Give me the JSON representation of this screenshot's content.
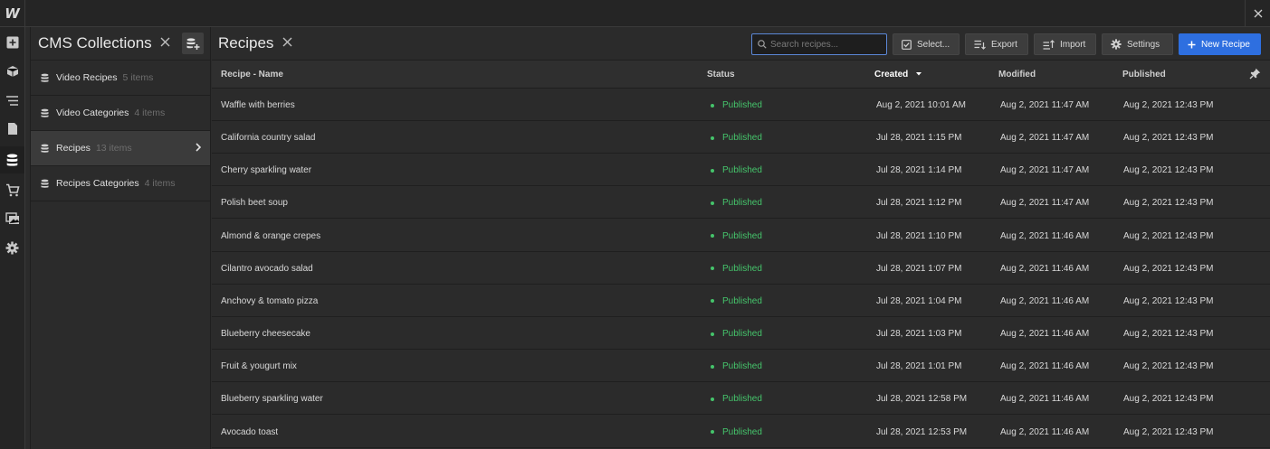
{
  "app": {
    "logo": "W"
  },
  "collections": {
    "title": "CMS Collections",
    "items": [
      {
        "name": "Video Recipes",
        "count": "5 items"
      },
      {
        "name": "Video Categories",
        "count": "4 items"
      },
      {
        "name": "Recipes",
        "count": "13 items"
      },
      {
        "name": "Recipes Categories",
        "count": "4 items"
      }
    ]
  },
  "main": {
    "title": "Recipes",
    "search_placeholder": "Search recipes...",
    "buttons": {
      "select": "Select...",
      "export": "Export",
      "import": "Import",
      "settings": "Settings",
      "new": "New Recipe"
    },
    "columns": {
      "name": "Recipe - Name",
      "status": "Status",
      "created": "Created",
      "modified": "Modified",
      "published": "Published"
    },
    "rows": [
      {
        "name": "Waffle with berries",
        "status": "Published",
        "created": "Aug 2, 2021 10:01 AM",
        "modified": "Aug 2, 2021 11:47 AM",
        "published": "Aug 2, 2021 12:43 PM"
      },
      {
        "name": "California country salad",
        "status": "Published",
        "created": "Jul 28, 2021 1:15 PM",
        "modified": "Aug 2, 2021 11:47 AM",
        "published": "Aug 2, 2021 12:43 PM"
      },
      {
        "name": "Cherry sparkling water",
        "status": "Published",
        "created": "Jul 28, 2021 1:14 PM",
        "modified": "Aug 2, 2021 11:47 AM",
        "published": "Aug 2, 2021 12:43 PM"
      },
      {
        "name": "Polish beet soup",
        "status": "Published",
        "created": "Jul 28, 2021 1:12 PM",
        "modified": "Aug 2, 2021 11:47 AM",
        "published": "Aug 2, 2021 12:43 PM"
      },
      {
        "name": "Almond & orange crepes",
        "status": "Published",
        "created": "Jul 28, 2021 1:10 PM",
        "modified": "Aug 2, 2021 11:46 AM",
        "published": "Aug 2, 2021 12:43 PM"
      },
      {
        "name": "Cilantro avocado salad",
        "status": "Published",
        "created": "Jul 28, 2021 1:07 PM",
        "modified": "Aug 2, 2021 11:46 AM",
        "published": "Aug 2, 2021 12:43 PM"
      },
      {
        "name": "Anchovy & tomato pizza",
        "status": "Published",
        "created": "Jul 28, 2021 1:04 PM",
        "modified": "Aug 2, 2021 11:46 AM",
        "published": "Aug 2, 2021 12:43 PM"
      },
      {
        "name": "Blueberry cheesecake",
        "status": "Published",
        "created": "Jul 28, 2021 1:03 PM",
        "modified": "Aug 2, 2021 11:46 AM",
        "published": "Aug 2, 2021 12:43 PM"
      },
      {
        "name": "Fruit & yougurt mix",
        "status": "Published",
        "created": "Jul 28, 2021 1:01 PM",
        "modified": "Aug 2, 2021 11:46 AM",
        "published": "Aug 2, 2021 12:43 PM"
      },
      {
        "name": "Blueberry sparkling water",
        "status": "Published",
        "created": "Jul 28, 2021 12:58 PM",
        "modified": "Aug 2, 2021 11:46 AM",
        "published": "Aug 2, 2021 12:43 PM"
      },
      {
        "name": "Avocado toast",
        "status": "Published",
        "created": "Jul 28, 2021 12:53 PM",
        "modified": "Aug 2, 2021 11:46 AM",
        "published": "Aug 2, 2021 12:43 PM"
      }
    ]
  },
  "colors": {
    "accent": "#2e6fe0",
    "published": "#45c46b",
    "background": "#2b2b2b"
  }
}
